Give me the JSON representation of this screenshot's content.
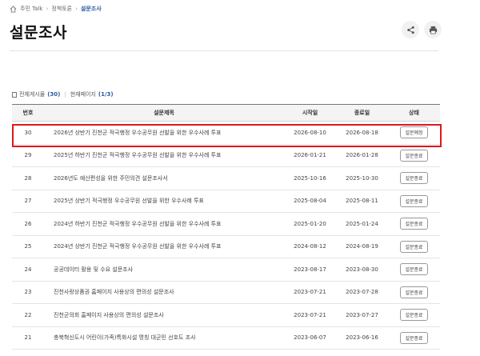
{
  "breadcrumb": {
    "items": [
      "주민 Talk",
      "정책토론"
    ],
    "current": "설문조사"
  },
  "page": {
    "title": "설문조사"
  },
  "tools": {
    "share_icon": "share-icon",
    "print_icon": "print-icon"
  },
  "summary": {
    "total_label": "전체게시물",
    "total_count": "(30)",
    "page_label": "현재페이지",
    "page_value": "(1/3)"
  },
  "table": {
    "headers": {
      "no": "번호",
      "title": "설문제목",
      "start": "시작일",
      "end": "종료일",
      "status": "상태"
    },
    "rows": [
      {
        "no": "30",
        "title": "2026년 상반기 진천군 적극행정 우수공무원 선발을 위한 우수사례 투표",
        "start": "2026-08-10",
        "end": "2026-08-18",
        "status": "설문예정"
      },
      {
        "no": "29",
        "title": "2025년 하반기 진천군 적극행정 우수공무원 선발을 위한 우수사례 투표",
        "start": "2026-01-21",
        "end": "2026-01-28",
        "status": "설문종료"
      },
      {
        "no": "28",
        "title": "2026년도 예산편성을 위한 주민의견 설문조사서",
        "start": "2025-10-16",
        "end": "2025-10-30",
        "status": "설문종료"
      },
      {
        "no": "27",
        "title": "2025년 상반기 적극행정 우수공무원 선발을 위한 우수사례 투표",
        "start": "2025-08-04",
        "end": "2025-08-11",
        "status": "설문종료"
      },
      {
        "no": "26",
        "title": "2024년 하반기 진천군 적극행정 우수공무원 선발을 위한 우수사례 투표",
        "start": "2025-01-20",
        "end": "2025-01-24",
        "status": "설문종료"
      },
      {
        "no": "25",
        "title": "2024년 상반기 진천군 적극행정 우수공무원 선발을 위한 우수사례 투표",
        "start": "2024-08-12",
        "end": "2024-08-19",
        "status": "설문종료"
      },
      {
        "no": "24",
        "title": "공공데이터 활용 및 수요 설문조사",
        "start": "2023-08-17",
        "end": "2023-08-30",
        "status": "설문종료"
      },
      {
        "no": "23",
        "title": "진천사랑상품권 홈페이지 사용상의 편의성 설문조사",
        "start": "2023-07-21",
        "end": "2023-07-28",
        "status": "설문종료"
      },
      {
        "no": "22",
        "title": "진천군의회 홈페이지 사용상의 편의성 설문조사",
        "start": "2023-07-21",
        "end": "2023-07-27",
        "status": "설문종료"
      },
      {
        "no": "21",
        "title": "충북혁신도시 어린이(가족)특화시설 명칭 대군민 선호도 조사",
        "start": "2023-06-07",
        "end": "2023-06-16",
        "status": "설문종료"
      }
    ]
  },
  "colors": {
    "accent": "#2c5aa0",
    "highlight": "#e0161e"
  }
}
